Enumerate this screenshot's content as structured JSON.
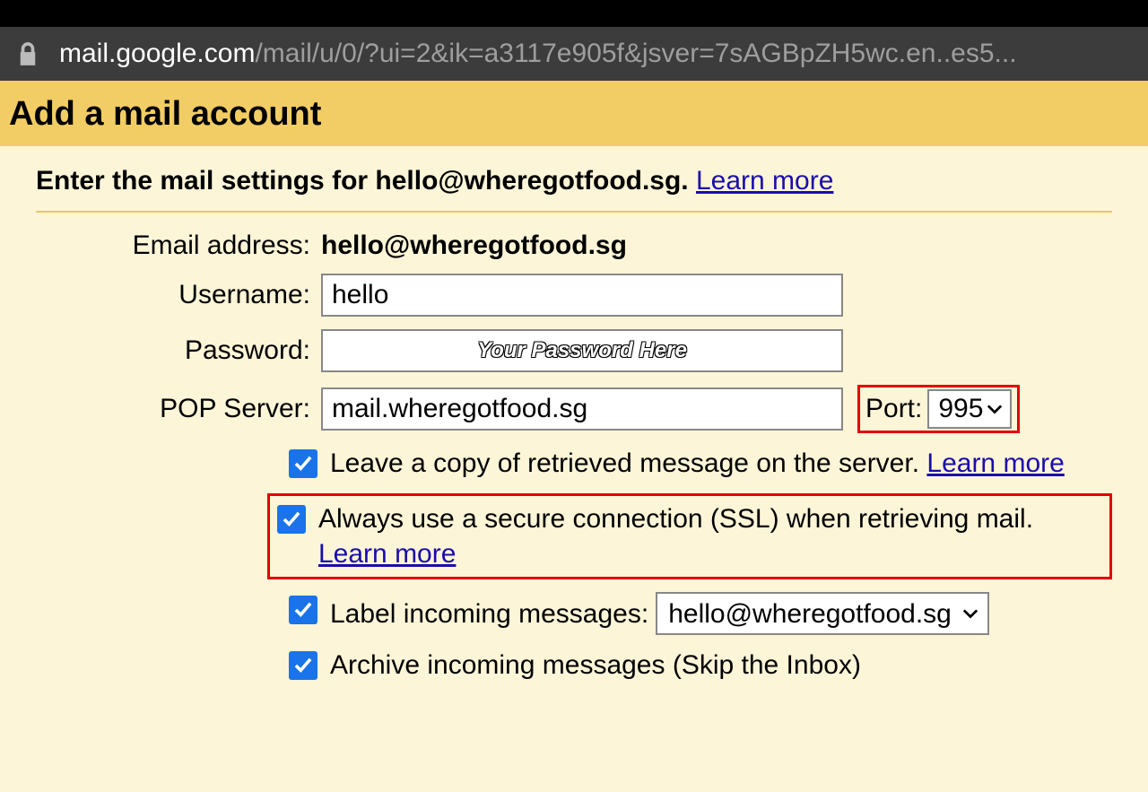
{
  "addressbar": {
    "domain": "mail.google.com",
    "path": "/mail/u/0/?ui=2&ik=a3117e905f&jsver=7sAGBpZH5wc.en..es5..."
  },
  "header": {
    "title": "Add a mail account"
  },
  "instruction": {
    "text_prefix": "Enter the mail settings for hello@wheregotfood.sg. ",
    "learn_more": "Learn more"
  },
  "form": {
    "email_label": "Email address:",
    "email_value": "hello@wheregotfood.sg",
    "username_label": "Username:",
    "username_value": "hello",
    "password_label": "Password:",
    "password_watermark": "Your Password Here",
    "pop_label": "POP Server:",
    "pop_value": "mail.wheregotfood.sg",
    "port_label": "Port:",
    "port_value": "995"
  },
  "options": {
    "leave_copy": "Leave a copy of retrieved message on the server. ",
    "leave_copy_link": "Learn more",
    "ssl_text": "Always use a secure connection (SSL) when retrieving mail.",
    "ssl_link": "Learn more",
    "label_text": "Label incoming messages:",
    "label_value": "hello@wheregotfood.sg",
    "archive_text": "Archive incoming messages (Skip the Inbox)"
  }
}
